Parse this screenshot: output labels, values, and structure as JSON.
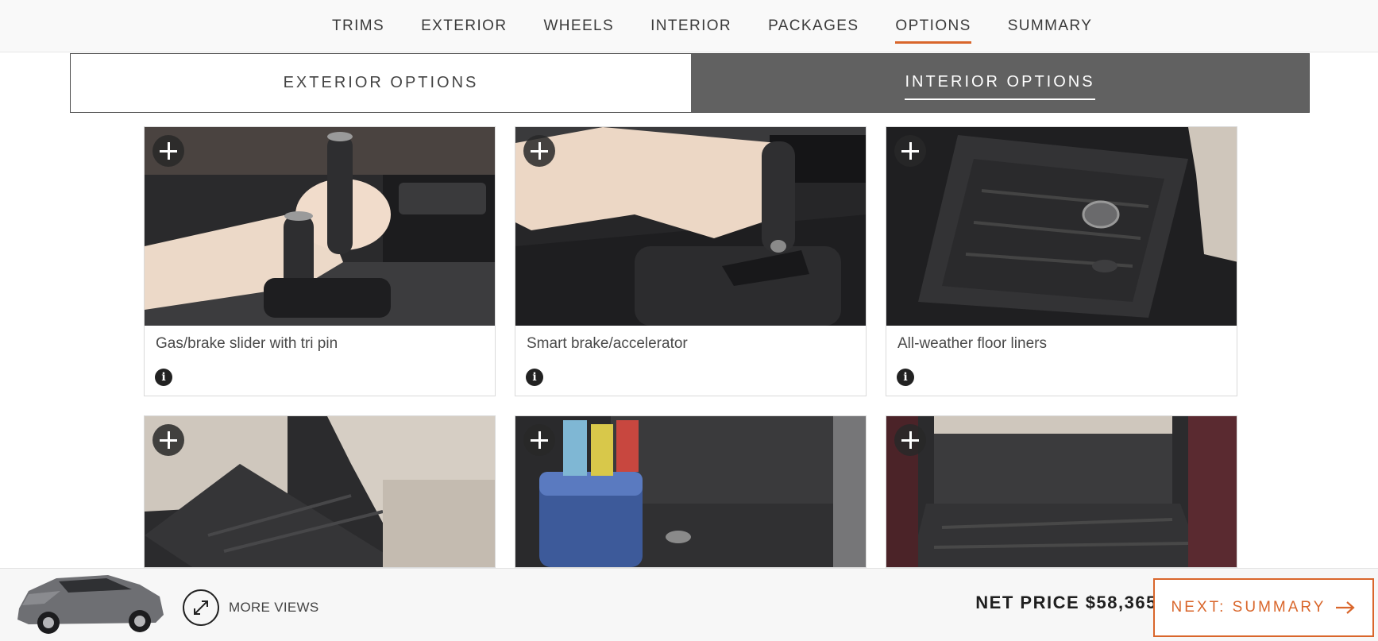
{
  "nav": {
    "items": [
      {
        "label": "TRIMS"
      },
      {
        "label": "EXTERIOR"
      },
      {
        "label": "WHEELS"
      },
      {
        "label": "INTERIOR"
      },
      {
        "label": "PACKAGES"
      },
      {
        "label": "OPTIONS",
        "active": true
      },
      {
        "label": "SUMMARY"
      }
    ]
  },
  "tabs": {
    "exterior": "EXTERIOR OPTIONS",
    "interior": "INTERIOR OPTIONS",
    "selected": "interior"
  },
  "cards": [
    {
      "title": "Gas/brake slider with tri pin",
      "image": "hand-control-slider-photo"
    },
    {
      "title": "Smart brake/accelerator",
      "image": "smart-brake-lever-photo"
    },
    {
      "title": "All-weather floor liners",
      "image": "floor-liner-photo"
    },
    {
      "title": "",
      "image": "second-row-floor-liner-photo"
    },
    {
      "title": "",
      "image": "cargo-area-liner-photo"
    },
    {
      "title": "",
      "image": "cargo-tray-liner-photo"
    }
  ],
  "bottom": {
    "more_views": "MORE VIEWS",
    "net_price_label": "NET PRICE",
    "net_price_value": "$58,365",
    "price_footnote": "‡",
    "next_button": "NEXT: SUMMARY"
  },
  "colors": {
    "accent": "#d9662b",
    "tab_selected_bg": "#616161"
  },
  "icons": [
    "plus-icon",
    "info-icon",
    "expand-icon",
    "arrow-right-icon"
  ]
}
